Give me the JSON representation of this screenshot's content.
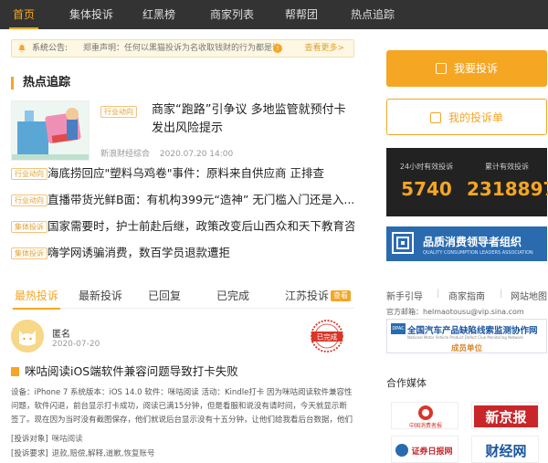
{
  "nav": {
    "items": [
      "首页",
      "集体投诉",
      "红黑榜",
      "商家列表",
      "帮帮团",
      "热点追踪"
    ],
    "active_index": 0
  },
  "notice": {
    "label": "系统公告:",
    "text": "郑重声明：任何以黑猫投诉为名收取钱财的行为都是诈骗",
    "more": "查看更多>"
  },
  "hot": {
    "section_title": "热点追踪",
    "featured": {
      "tag": "行业动向",
      "title": "商家“跑路”引争议 多地监管就预付卡发出风险提示",
      "source": "新浪财经综合",
      "time": "2020.07.20 14:00"
    },
    "items": [
      {
        "tag": "行业动向",
        "title": "海底捞回应\"塑料乌鸡卷\"事件：原料来自供应商 正排查"
      },
      {
        "tag": "行业动向",
        "title": "直播带货光鲜B面：有机构399元“造神” 无门槛入门还是入..."
      },
      {
        "tag": "集体投诉",
        "title": "国家需要时，护士前赴后继，政策改变后山西众和天下教育咨..."
      },
      {
        "tag": "集体投诉",
        "title": "嗨学网诱骗消费，数百学员退款遭拒"
      }
    ]
  },
  "tabs": {
    "items": [
      "最热投诉",
      "最新投诉",
      "已回复",
      "已完成",
      "江苏投诉"
    ],
    "active_index": 0,
    "badge": "查看"
  },
  "complaint": {
    "user": "匿名",
    "date": "2020-07-20",
    "stamp": "已完成",
    "title": "咪咕阅读iOS端软件兼容问题导致打卡失败",
    "body": "设备：iPhone 7 系统版本：iOS 14.0 软件：咪咕阅读 活动：Kindle打卡 因为咪咕阅读软件兼容性问题，软件闪退，前台显示打卡成功，阅读已满15分钟，但是看服和说没有请时间，今天就显示断签了。现在因为当时没有截图保存，他们就说后台显示没有十五分钟，让他们给我看后台数据，他们不行。",
    "target_label": "[投诉对象]",
    "target_value": "咪咕阅读",
    "request_label": "[投诉要求]",
    "request_value": "退款,赔偿,解释,道歉,恢复账号"
  },
  "sidebar": {
    "primary_button": "我要投诉",
    "secondary_button": "我的投诉单",
    "stats": [
      {
        "label": "24小时有效投诉",
        "value": "5740"
      },
      {
        "label": "累计有效投诉",
        "value": "2318897"
      }
    ],
    "banner": {
      "title": "品质消费领导者组织",
      "subtitle": "QUALITY CONSUMPTION LEADERS ASSOCIATION"
    },
    "links": [
      "新手引导",
      "商家指南",
      "网站地图"
    ],
    "weibo": "官方邮箱：helmaotousu@vip.sina.com",
    "promo": {
      "logo": "DPAC",
      "title": "全国汽车产品缺陷线索监测协作网",
      "subtitle": "National Motor Vehicle Product Defect Clue Monitoring Network",
      "unit": "成员单位"
    },
    "coop_title": "合作媒体",
    "coop_logos": [
      "中国消费者报",
      "新京报",
      "证券日报网",
      "财经网"
    ]
  },
  "colors": {
    "accent": "#f5a623",
    "nav_bg": "#333333",
    "stats_bg": "#222222",
    "banner_bg": "#2a6bb0"
  }
}
